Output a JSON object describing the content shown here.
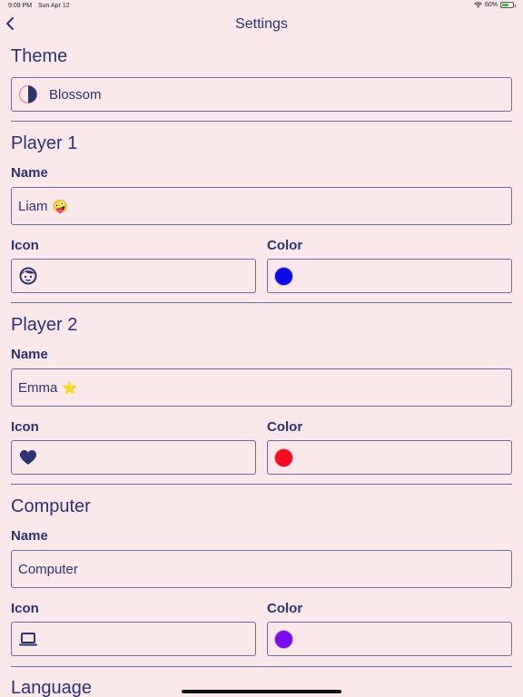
{
  "status_bar": {
    "time": "9:09 PM",
    "date": "Sun Apr 12",
    "battery": "60%",
    "battery_level": 0.6
  },
  "nav": {
    "title": "Settings",
    "back_icon": "chevron-left-icon"
  },
  "theme": {
    "title": "Theme",
    "value": "Blossom",
    "icon": "half-circle-icon"
  },
  "player1": {
    "title": "Player 1",
    "name_label": "Name",
    "name_value": "Liam",
    "name_emoji": "🤪",
    "icon_label": "Icon",
    "icon": "face-icon",
    "color_label": "Color",
    "color": "#0a0af0"
  },
  "player2": {
    "title": "Player 2",
    "name_label": "Name",
    "name_value": "Emma",
    "name_emoji": "⭐",
    "icon_label": "Icon",
    "icon": "heart-icon",
    "color_label": "Color",
    "color": "#ff0a20"
  },
  "computer": {
    "title": "Computer",
    "name_label": "Name",
    "name_value": "Computer",
    "icon_label": "Icon",
    "icon": "laptop-icon",
    "color_label": "Color",
    "color": "#7a0af0"
  },
  "language": {
    "title": "Language"
  },
  "colors": {
    "background": "#fae8ea",
    "accent": "#2e3270",
    "border": "#6f6c9c"
  }
}
